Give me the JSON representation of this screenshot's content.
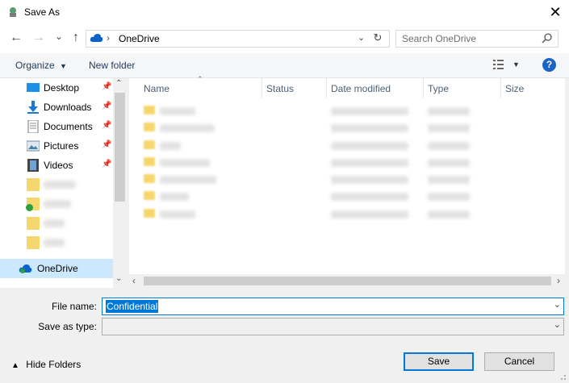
{
  "window": {
    "title": "Save As"
  },
  "nav": {
    "back": "←",
    "forward": "→",
    "recent": "⌄",
    "up": "↑",
    "address": {
      "separator": "›",
      "location": "OneDrive"
    },
    "search": {
      "placeholder": "Search OneDrive"
    }
  },
  "commands": {
    "organize": "Organize",
    "new_folder": "New folder"
  },
  "sidebar": {
    "items": [
      {
        "label": "Desktop"
      },
      {
        "label": "Downloads"
      },
      {
        "label": "Documents"
      },
      {
        "label": "Pictures"
      },
      {
        "label": "Videos"
      }
    ],
    "onedrive": {
      "label": "OneDrive"
    }
  },
  "columns": [
    "Name",
    "Status",
    "Date modified",
    "Type",
    "Size"
  ],
  "form": {
    "file_name_label": "File name:",
    "file_name_value": "Confidential",
    "save_type_label": "Save as type:"
  },
  "footer": {
    "hide_folders": "Hide Folders",
    "save": "Save",
    "cancel": "Cancel"
  },
  "colors": {
    "accent": "#0078d7",
    "help": "#1a64c8"
  }
}
